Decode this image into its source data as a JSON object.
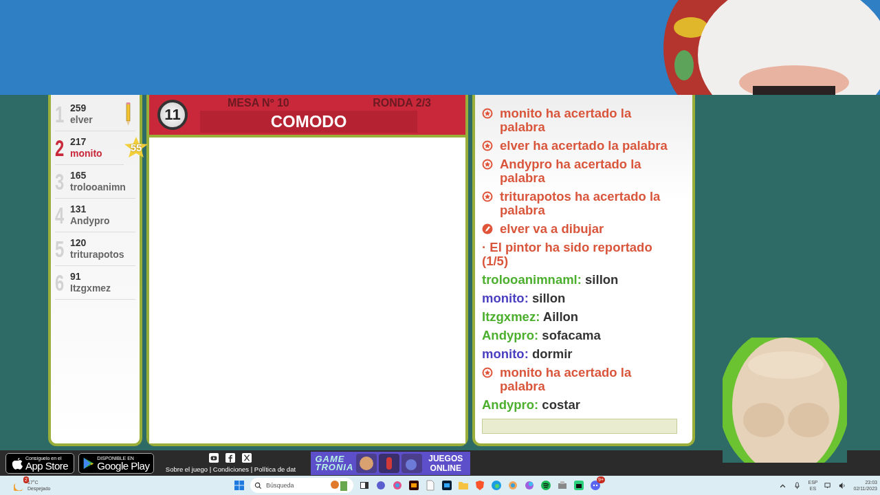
{
  "players": [
    {
      "rank": "1",
      "score": "259",
      "name": "elver",
      "highlighted": false,
      "drawing": true
    },
    {
      "rank": "2",
      "score": "217",
      "name": "monito",
      "highlighted": true,
      "drawing": false,
      "badge": "55"
    },
    {
      "rank": "3",
      "score": "165",
      "name": "trolooanimn",
      "highlighted": false,
      "drawing": false
    },
    {
      "rank": "4",
      "score": "131",
      "name": "Andypro",
      "highlighted": false,
      "drawing": false
    },
    {
      "rank": "5",
      "score": "120",
      "name": "triturapotos",
      "highlighted": false,
      "drawing": false
    },
    {
      "rank": "6",
      "score": "91",
      "name": "Itzgxmez",
      "highlighted": false,
      "drawing": false
    }
  ],
  "board": {
    "turn": "11",
    "table": "MESA Nº 10",
    "round": "RONDA 2/3",
    "word": "COMODO"
  },
  "chat": [
    {
      "kind": "event",
      "text": "monito ha acertado la palabra"
    },
    {
      "kind": "event",
      "text": "elver ha acertado la palabra"
    },
    {
      "kind": "event",
      "text": "Andypro ha acertado la palabra"
    },
    {
      "kind": "event",
      "text": "triturapotos ha acertado la palabra"
    },
    {
      "kind": "draw",
      "text": "elver va a dibujar"
    },
    {
      "kind": "notice",
      "text": "· El pintor ha sido reportado (1/5)"
    },
    {
      "kind": "message",
      "user": "trolooanimnaml:",
      "color": "#4caf2e",
      "text": "sillon"
    },
    {
      "kind": "message",
      "user": "monito:",
      "color": "#4a3fc0",
      "text": "sillon"
    },
    {
      "kind": "message",
      "user": "Itzgxmez:",
      "color": "#4caf2e",
      "text": "Aillon"
    },
    {
      "kind": "message",
      "user": "Andypro:",
      "color": "#4caf2e",
      "text": "sofacama"
    },
    {
      "kind": "message",
      "user": "monito:",
      "color": "#4a3fc0",
      "text": "dormir"
    },
    {
      "kind": "event",
      "text": "monito ha acertado la palabra"
    },
    {
      "kind": "message",
      "user": "Andypro:",
      "color": "#4caf2e",
      "text": "costar"
    }
  ],
  "footer": {
    "app_store": {
      "small": "Consíguelo en el",
      "big": "App Store"
    },
    "google_play": {
      "small": "DISPONIBLE EN",
      "big": "Google Play"
    },
    "links": "Sobre el juego | Condiciones | Política de dat",
    "banner": {
      "logo_top": "GAME",
      "logo_bottom": "TRONIA",
      "label": "JUEGOS ONLINE"
    }
  },
  "taskbar": {
    "weather_badge": "2",
    "temperature": "17°C",
    "weather": "Despejado",
    "search": "Búsqueda",
    "discord_badge": "9+",
    "lang_top": "ESP",
    "lang_bottom": "ES",
    "time": "23:03",
    "date": "02/11/2023"
  }
}
